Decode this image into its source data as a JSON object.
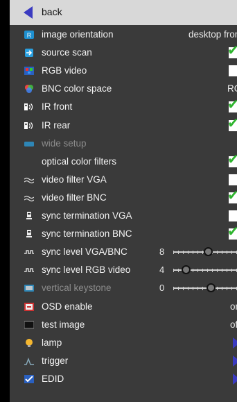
{
  "back": {
    "label": "back"
  },
  "colors": {
    "background": "#3a3a3a",
    "header": "#d8d8d8",
    "accent": "#3a3ac0",
    "check": "#2fb52f"
  },
  "rows": [
    {
      "label": "image orientation",
      "icon": "orientation-icon",
      "control": "text",
      "value": "desktop front"
    },
    {
      "label": "source scan",
      "icon": "source-scan-icon",
      "control": "checkbox",
      "checked": true
    },
    {
      "label": "RGB video",
      "icon": "rgb-video-icon",
      "control": "checkbox",
      "checked": false
    },
    {
      "label": "BNC color space",
      "icon": "color-space-icon",
      "control": "text",
      "value": "RGB"
    },
    {
      "label": "IR front",
      "icon": "ir-sensor-icon",
      "control": "checkbox",
      "checked": true
    },
    {
      "label": "IR rear",
      "icon": "ir-sensor-icon",
      "control": "checkbox",
      "checked": true
    },
    {
      "label": "wide setup",
      "icon": "wide-setup-icon",
      "control": "none",
      "disabled": true
    },
    {
      "label": "optical color filters",
      "icon": "",
      "control": "checkbox",
      "checked": true
    },
    {
      "label": "video filter VGA",
      "icon": "wave-filter-icon",
      "control": "checkbox",
      "checked": false
    },
    {
      "label": "video filter BNC",
      "icon": "wave-filter-icon",
      "control": "checkbox",
      "checked": true
    },
    {
      "label": "sync termination VGA",
      "icon": "termination-icon",
      "control": "checkbox",
      "checked": false
    },
    {
      "label": "sync termination BNC",
      "icon": "termination-icon",
      "control": "checkbox",
      "checked": true
    },
    {
      "label": "sync level VGA/BNC",
      "icon": "sync-level-icon",
      "control": "slider",
      "value": "8",
      "level": 0.55
    },
    {
      "label": "sync level RGB video",
      "icon": "sync-level-icon",
      "control": "slider",
      "value": "4",
      "level": 0.2
    },
    {
      "label": "vertical keystone",
      "icon": "keystone-icon",
      "control": "slider",
      "value": "0",
      "level": 0.6,
      "disabled": true
    },
    {
      "label": "OSD enable",
      "icon": "osd-icon",
      "control": "text",
      "value": "on"
    },
    {
      "label": "test image",
      "icon": "test-image-icon",
      "control": "text",
      "value": "off"
    },
    {
      "label": "lamp",
      "icon": "lamp-icon",
      "control": "submenu"
    },
    {
      "label": "trigger",
      "icon": "trigger-icon",
      "control": "submenu"
    },
    {
      "label": "EDID",
      "icon": "edid-icon",
      "control": "submenu"
    }
  ]
}
